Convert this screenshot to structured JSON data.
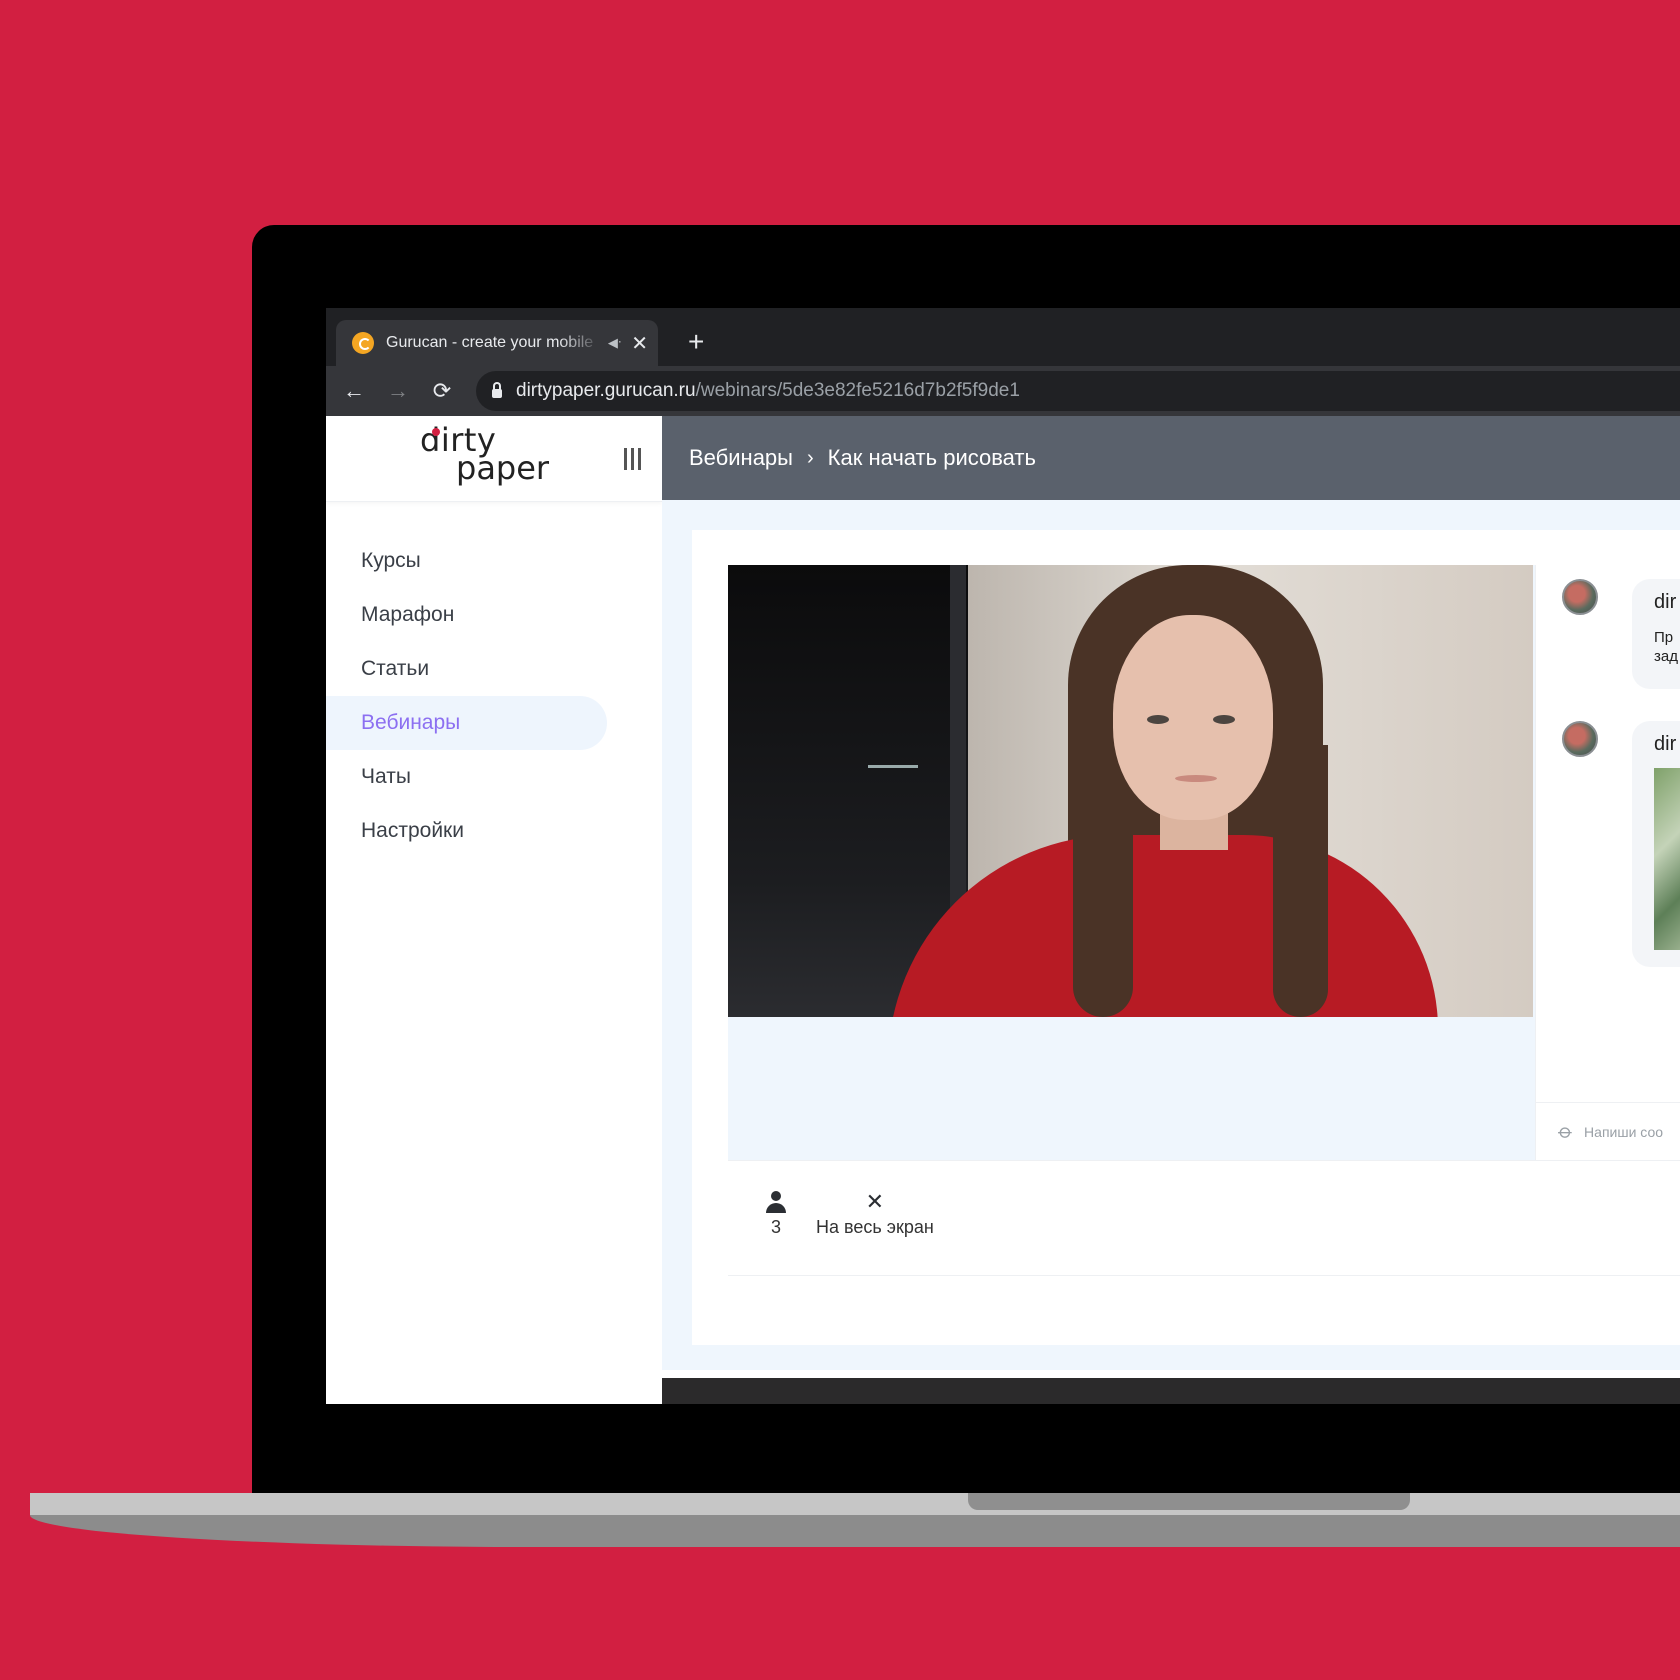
{
  "browser": {
    "tab_title": "Gurucan - create your mobile",
    "tab_mute_icon": "speaker-muted-icon",
    "tab_close": "✕",
    "new_tab": "+",
    "back": "←",
    "forward": "→",
    "reload": "⟳",
    "url_host": "dirtypaper.gurucan.ru",
    "url_path": "/webinars/5de3e82fe5216d7b2f5f9de1"
  },
  "logo": {
    "line1": "dirty",
    "line2": "paper"
  },
  "sidebar": {
    "items": [
      {
        "label": "Курсы"
      },
      {
        "label": "Марафон"
      },
      {
        "label": "Статьи"
      },
      {
        "label": "Вебинары",
        "active": true
      },
      {
        "label": "Чаты"
      },
      {
        "label": "Настройки"
      }
    ]
  },
  "breadcrumb": {
    "root": "Вебинары",
    "separator": "›",
    "current": "Как начать рисовать"
  },
  "chat": {
    "messages": [
      {
        "author": "dir",
        "text_line1": "Пр",
        "text_line2": "зад"
      },
      {
        "author": "dir",
        "has_image": true
      }
    ],
    "input_placeholder": "Напиши соо"
  },
  "controls": {
    "viewers_count": "3",
    "fullscreen_label": "На весь экран",
    "fullscreen_icon": "✕"
  },
  "colors": {
    "background": "#d21f41",
    "accent": "#8c6ff1",
    "topbar": "#5a616c"
  }
}
